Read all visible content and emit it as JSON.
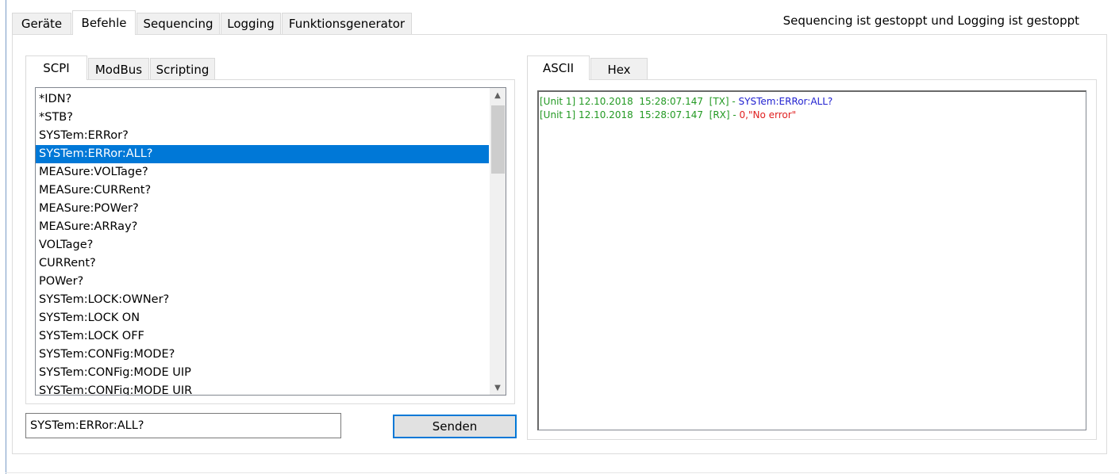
{
  "main_tabs": [
    {
      "label": "Geräte",
      "active": false
    },
    {
      "label": "Befehle",
      "active": true
    },
    {
      "label": "Sequencing",
      "active": false
    },
    {
      "label": "Logging",
      "active": false
    },
    {
      "label": "Funktionsgenerator",
      "active": false
    }
  ],
  "status_text": "Sequencing ist gestoppt und Logging ist gestoppt",
  "left_tabs": [
    {
      "label": "SCPI",
      "active": true
    },
    {
      "label": "ModBus",
      "active": false
    },
    {
      "label": "Scripting",
      "active": false
    }
  ],
  "commands": [
    "*IDN?",
    "*STB?",
    "SYSTem:ERRor?",
    "SYSTem:ERRor:ALL?",
    "MEASure:VOLTage?",
    "MEASure:CURRent?",
    "MEASure:POWer?",
    "MEASure:ARRay?",
    "VOLTage?",
    "CURRent?",
    "POWer?",
    "SYSTem:LOCK:OWNer?",
    "SYSTem:LOCK ON",
    "SYSTem:LOCK OFF",
    "SYSTem:CONFig:MODE?",
    "SYSTem:CONFig:MODE UIP",
    "SYSTem:CONFig:MODE UIR"
  ],
  "selected_command_index": 3,
  "command_input": {
    "value": "SYSTem:ERRor:ALL?"
  },
  "send_button": "Senden",
  "scroll_icons": {
    "up": "chevron-up-icon",
    "down": "chevron-down-icon"
  },
  "right_tabs": [
    {
      "label": "ASCII",
      "active": true
    },
    {
      "label": "Hex",
      "active": false
    }
  ],
  "log": [
    {
      "prefix": "[Unit 1] 12.10.2018  15:28:07.147  [TX] - ",
      "message": "SYSTem:ERRor:ALL?",
      "message_color": "#1f1fd0"
    },
    {
      "prefix": "[Unit 1] 12.10.2018  15:28:07.147  [RX] - ",
      "message": "0,\"No error\"",
      "message_color": "#e02020"
    }
  ],
  "colors": {
    "selection": "#0078d7",
    "log_prefix": "#229922",
    "tx": "#1f1fd0",
    "rx": "#e02020"
  }
}
